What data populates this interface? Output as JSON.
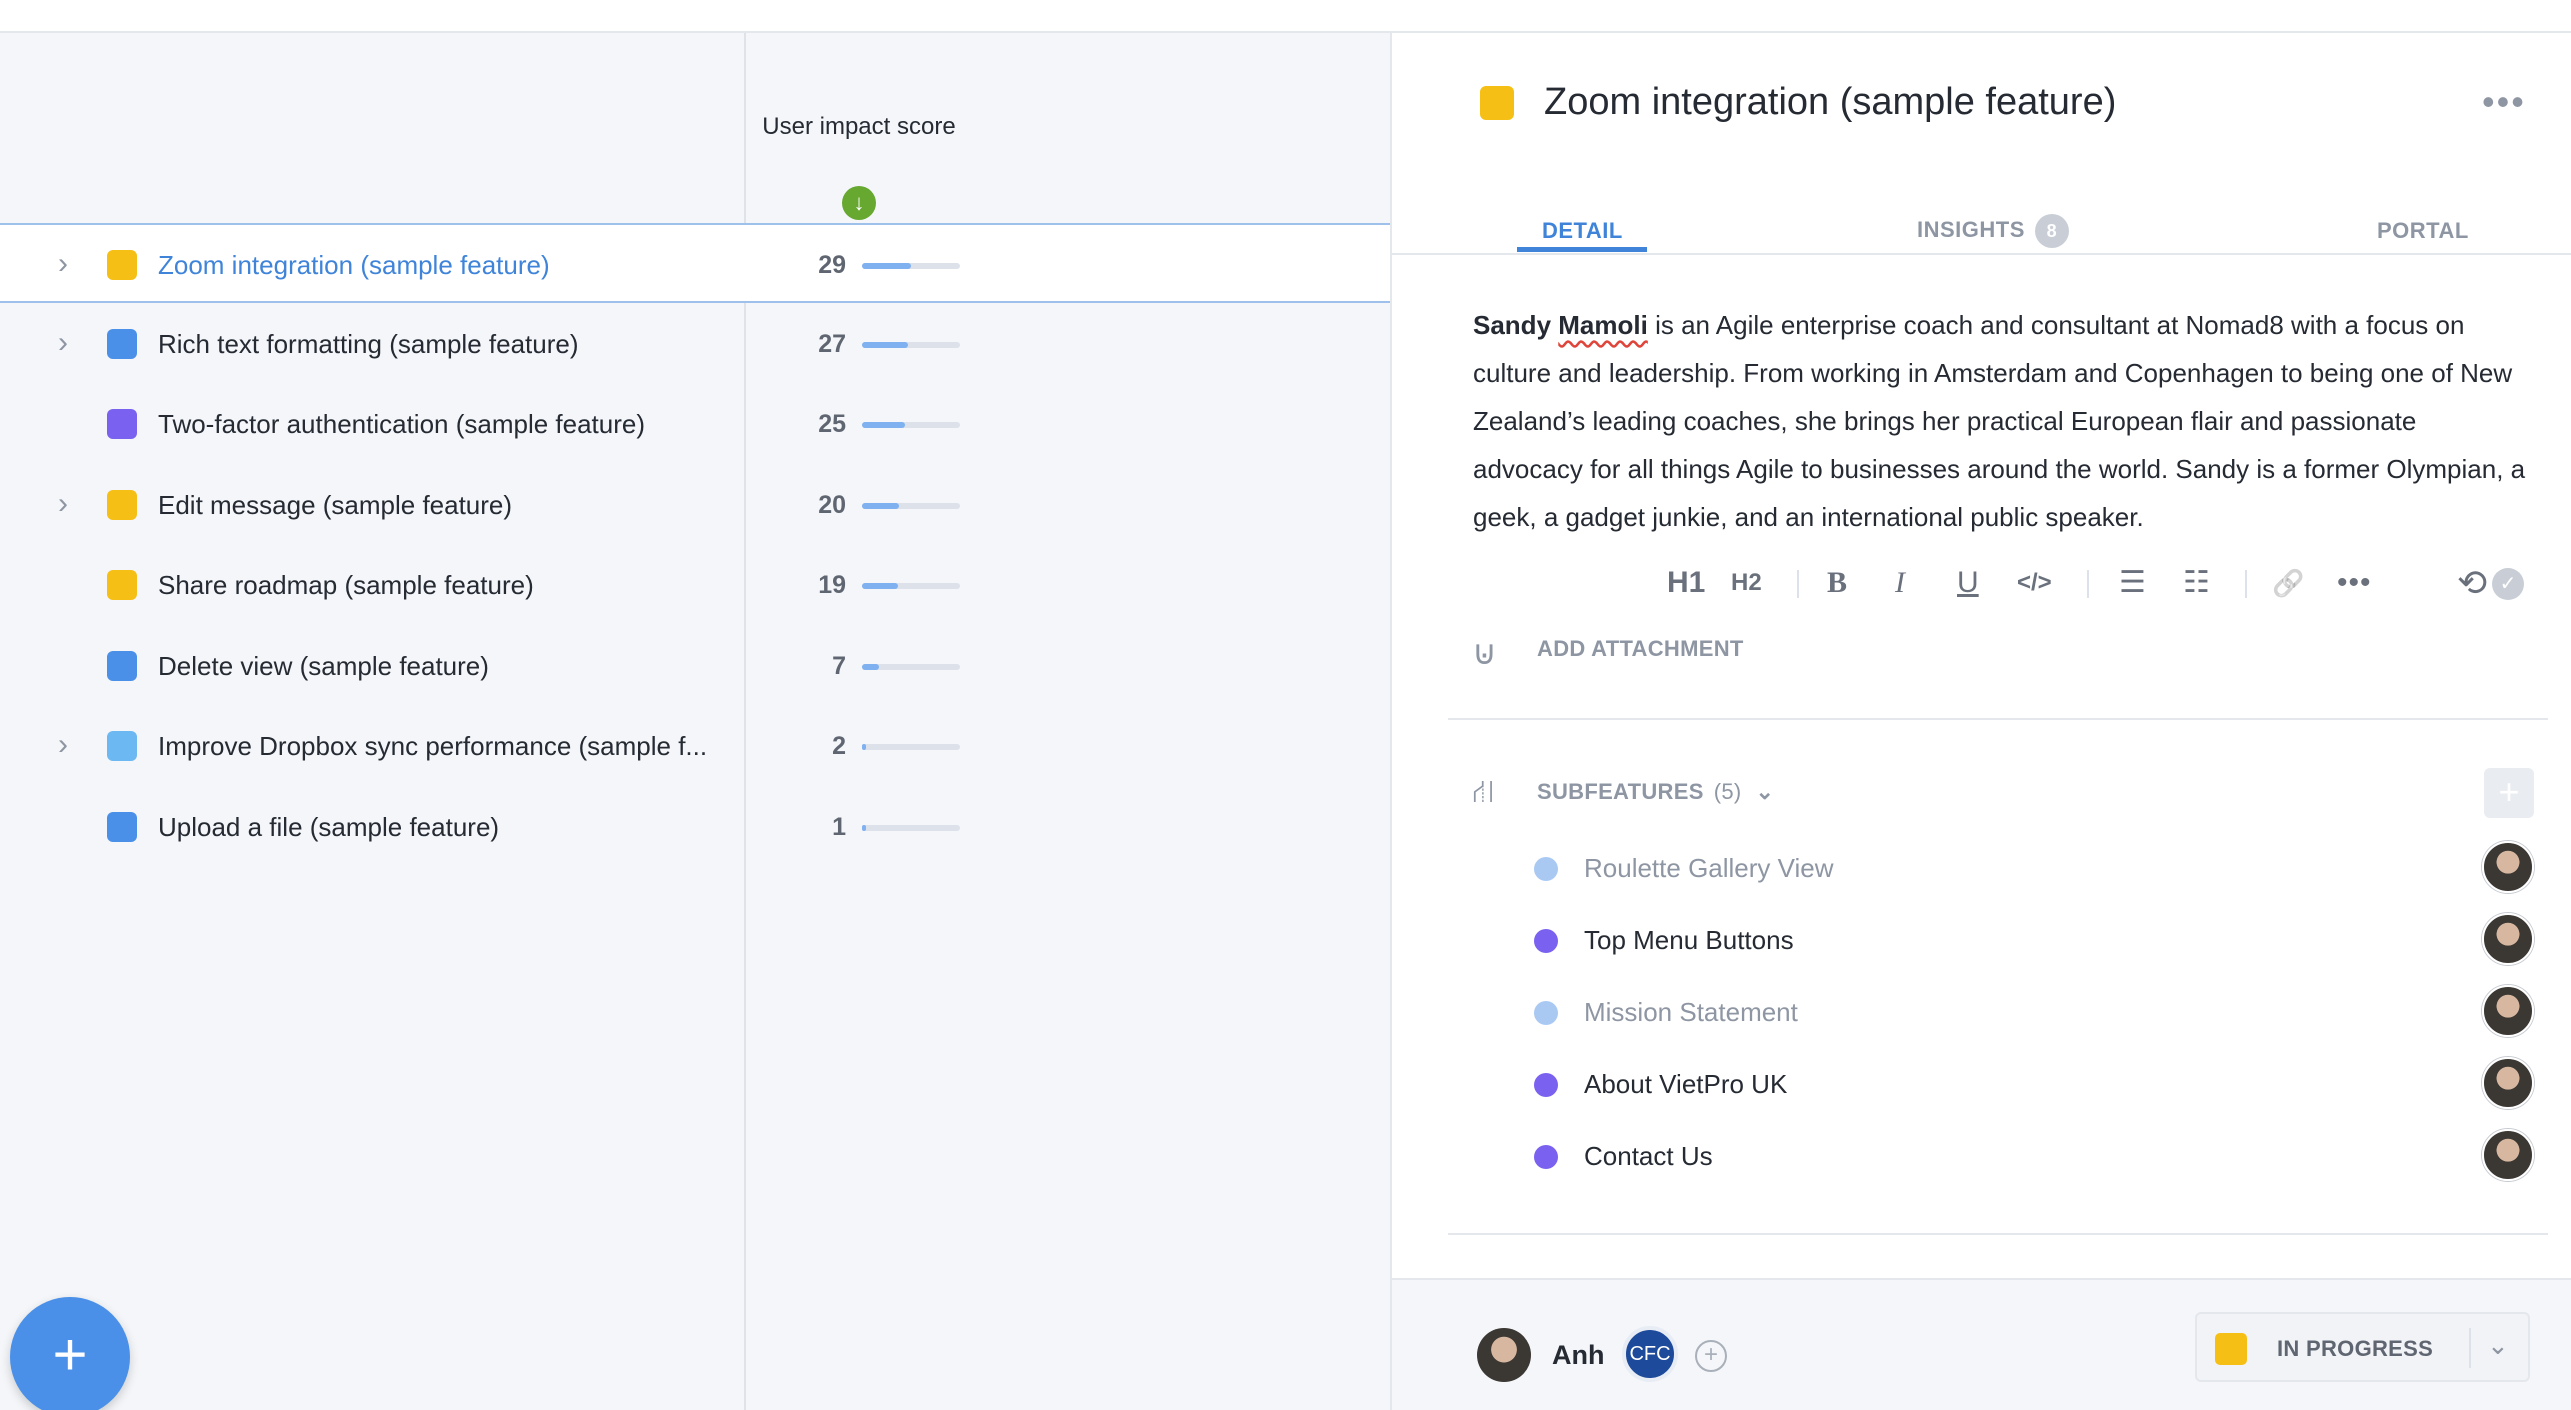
{
  "list": {
    "column_header": "User impact score",
    "sort_icon": "arrow-down-icon",
    "rows": [
      {
        "name": "Zoom integration (sample feature)",
        "score": "29",
        "score_fraction": 0.5,
        "color": "#f6bf16",
        "expandable": true,
        "selected": true
      },
      {
        "name": "Rich text formatting (sample feature)",
        "score": "27",
        "score_fraction": 0.47,
        "color": "#4a90e8",
        "expandable": true,
        "selected": false
      },
      {
        "name": "Two-factor authentication (sample feature)",
        "score": "25",
        "score_fraction": 0.44,
        "color": "#7b61f0",
        "expandable": false,
        "selected": false
      },
      {
        "name": "Edit message (sample feature)",
        "score": "20",
        "score_fraction": 0.38,
        "color": "#f6bf16",
        "expandable": true,
        "selected": false
      },
      {
        "name": "Share roadmap (sample feature)",
        "score": "19",
        "score_fraction": 0.37,
        "color": "#f6bf16",
        "expandable": false,
        "selected": false
      },
      {
        "name": "Delete view (sample feature)",
        "score": "7",
        "score_fraction": 0.17,
        "color": "#4a90e8",
        "expandable": false,
        "selected": false
      },
      {
        "name": "Improve Dropbox sync performance (sample f...",
        "score": "2",
        "score_fraction": 0.04,
        "color": "#6cb8f2",
        "expandable": true,
        "selected": false
      },
      {
        "name": "Upload a file (sample feature)",
        "score": "1",
        "score_fraction": 0.02,
        "color": "#4a90e8",
        "expandable": false,
        "selected": false
      }
    ]
  },
  "fab": {
    "label": "+"
  },
  "detail": {
    "title": "Zoom integration (sample feature)",
    "title_color": "#f6bf16",
    "more_label": "•••",
    "tabs": [
      {
        "label": "DETAIL",
        "active": true
      },
      {
        "label": "INSIGHTS",
        "badge": "8",
        "active": false
      },
      {
        "label": "PORTAL",
        "active": false
      }
    ],
    "description": {
      "name_first": "Sandy",
      "name_last": "Mamoli",
      "text": " is an Agile enterprise coach and consultant at Nomad8 with a focus on culture and leadership. From working in Amsterdam and Copenhagen to being one of New Zealand’s leading coaches, she brings her practical European flair and passionate advocacy for all things Agile to businesses around the world. Sandy is a former Olympian, a geek, a gadget junkie, and an international public speaker."
    },
    "toolbar": {
      "h1": "H1",
      "h2": "H2",
      "bold": "B",
      "italic": "I",
      "underline": "U",
      "code": "</>",
      "bullets": "☰",
      "numbered": "☷",
      "link": "🔗",
      "more": "•••",
      "history": "⟲",
      "check": "✓"
    },
    "attachment": {
      "label": "ADD ATTACHMENT",
      "icon": "paperclip-icon"
    },
    "subfeatures": {
      "label": "SUBFEATURES",
      "count": "(5)",
      "add_label": "+",
      "items": [
        {
          "name": "Roulette Gallery View",
          "dot_color": "#a9c9f3",
          "text_color": "#8e96a3"
        },
        {
          "name": "Top Menu Buttons",
          "dot_color": "#7b61f0",
          "text_color": "#252a33"
        },
        {
          "name": "Mission Statement",
          "dot_color": "#a9c9f3",
          "text_color": "#8e96a3"
        },
        {
          "name": "About VietPro UK",
          "dot_color": "#7b61f0",
          "text_color": "#252a33"
        },
        {
          "name": "Contact Us",
          "dot_color": "#7b61f0",
          "text_color": "#252a33"
        }
      ]
    },
    "footer": {
      "owner_name": "Anh",
      "team_initials": "CFC",
      "add_label": "+",
      "status_label": "IN PROGRESS",
      "status_color": "#f6bf16"
    }
  }
}
